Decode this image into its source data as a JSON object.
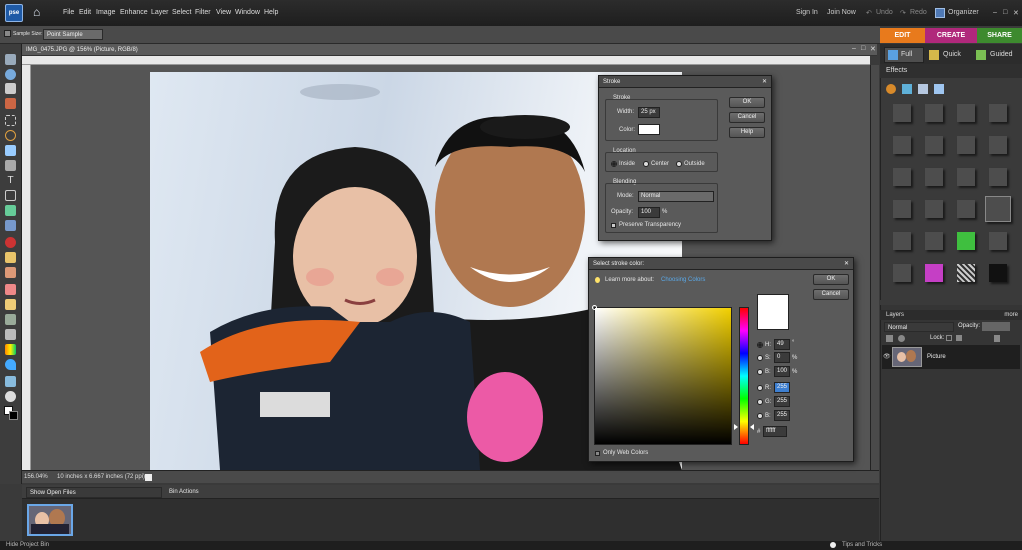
{
  "menubar": {
    "logo": "pse",
    "items": [
      "File",
      "Edit",
      "Image",
      "Enhance",
      "Layer",
      "Select",
      "Filter",
      "View",
      "Window",
      "Help"
    ],
    "right": [
      "Sign In",
      "Join Now",
      "Undo",
      "Redo",
      "Organizer"
    ]
  },
  "options": {
    "sample_size_label": "Sample Size:",
    "sample_size_value": "Point Sample"
  },
  "modes": {
    "tabs": [
      "EDIT",
      "CREATE",
      "SHARE"
    ],
    "subtabs": [
      "Full",
      "Quick",
      "Guided"
    ],
    "colors": {
      "edit": "#e87a1c",
      "create": "#b0287b",
      "share": "#3d8a2e"
    }
  },
  "document": {
    "title": "IMG_0475.JPG @ 156% (Picture, RGB/8)",
    "zoom": "156.04%",
    "size": "10 inches x 6.667 inches (72 ppi)"
  },
  "bin": {
    "select": "Show Open Files",
    "actions": "Bin Actions",
    "footer_left": "Hide Project Bin",
    "footer_right": "Tips and Tricks"
  },
  "effects": {
    "title": "Effects"
  },
  "layers": {
    "title": "Layers",
    "more": "more",
    "blend": "Normal",
    "opacity_label": "Opacity:",
    "lock_label": "Lock:",
    "layer_name": "Picture"
  },
  "stroke": {
    "title": "Stroke",
    "stroke_group": "Stroke",
    "width_label": "Width:",
    "width_value": "25 px",
    "color_label": "Color:",
    "location_group": "Location",
    "loc_inside": "Inside",
    "loc_center": "Center",
    "loc_outside": "Outside",
    "blending_group": "Blending",
    "mode_label": "Mode:",
    "mode_value": "Normal",
    "opacity_label": "Opacity:",
    "opacity_value": "100",
    "opacity_unit": "%",
    "preserve": "Preserve Transparency",
    "ok": "OK",
    "cancel": "Cancel",
    "help": "Help"
  },
  "picker": {
    "title": "Select stroke color:",
    "learn": "Learn more about:",
    "learn_link": "Choosing Colors",
    "ok": "OK",
    "cancel": "Cancel",
    "h_label": "H:",
    "h_value": "49",
    "h_unit": "°",
    "s_label": "S:",
    "s_value": "0",
    "s_unit": "%",
    "b_label": "B:",
    "b_value": "100",
    "b_unit": "%",
    "r_label": "R:",
    "r_value": "255",
    "g_label": "G:",
    "g_value": "255",
    "bb_label": "B:",
    "bb_value": "255",
    "hex_label": "#",
    "hex_value": "ffffff",
    "web_only": "Only Web Colors"
  }
}
